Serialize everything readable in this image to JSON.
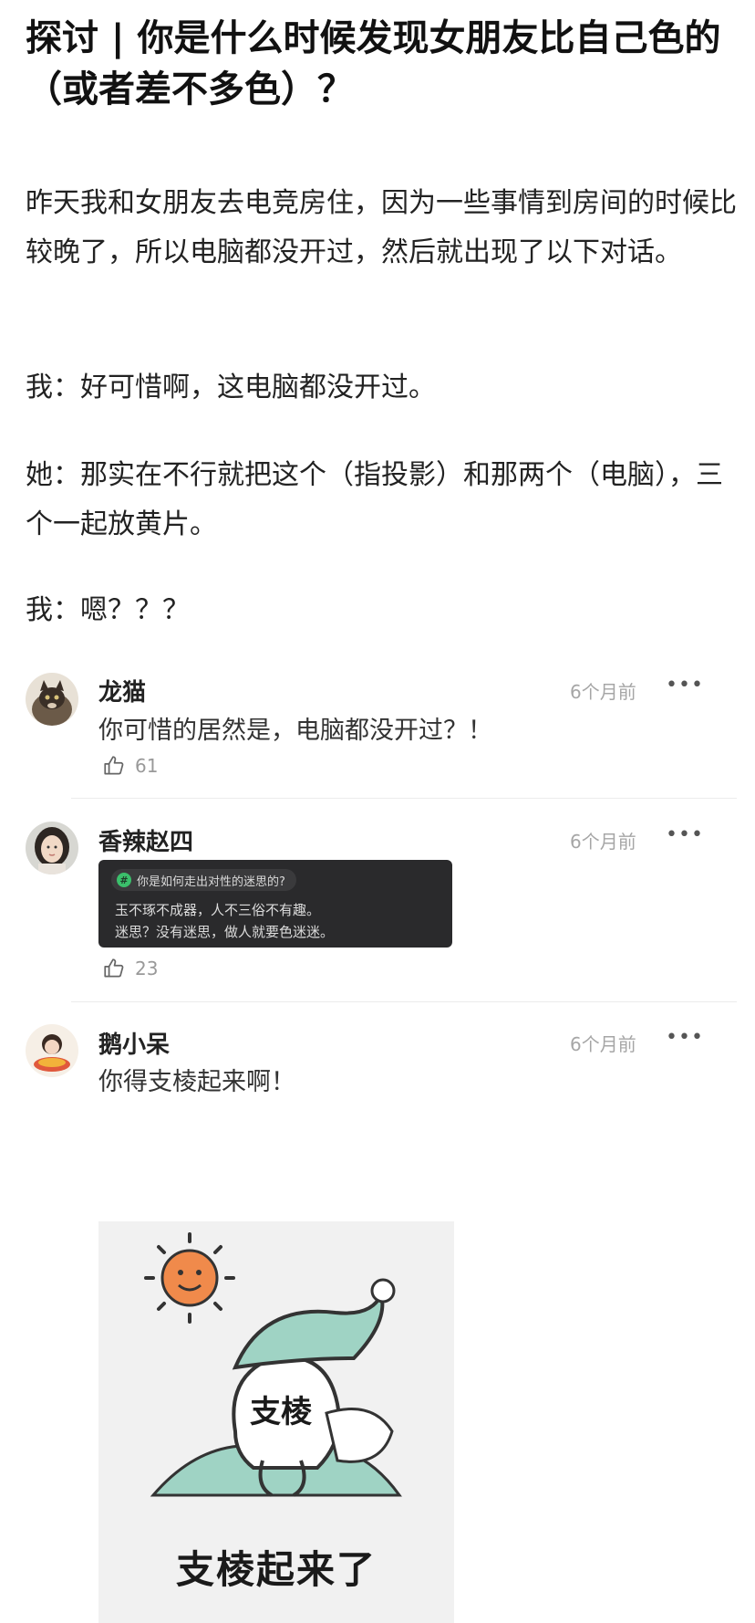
{
  "post": {
    "title": "探讨 | 你是什么时候发现女朋友比自己色的（或者差不多色）？",
    "paragraphs": [
      "昨天我和女朋友去电竞房住，因为一些事情到房间的时候比较晚了，所以电脑都没开过，然后就出现了以下对话。",
      "我：好可惜啊，这电脑都没开过。",
      "她：那实在不行就把这个（指投影）和那两个（电脑），三个一起放黄片。",
      "我：嗯？？？"
    ]
  },
  "comments": [
    {
      "name": "龙猫",
      "time": "6个月前",
      "text": "你可惜的居然是，电脑都没开过？！",
      "likes": "61",
      "avatar_icon": "cat-avatar"
    },
    {
      "name": "香辣赵四",
      "time": "6个月前",
      "quote_topic": "你是如何走出对性的迷思的?",
      "quote_lines": [
        "玉不琢不成器，人不三俗不有趣。",
        "迷思？没有迷思，做人就要色迷迷。"
      ],
      "likes": "23",
      "avatar_icon": "woman-avatar"
    },
    {
      "name": "鹅小呆",
      "time": "6个月前",
      "text": "你得支棱起来啊！",
      "avatar_icon": "girl-avatar",
      "meme_label": "支棱",
      "meme_caption": "支棱起来了"
    }
  ],
  "more_label": "•••",
  "colors": {
    "quote_bg": "#2a2a2c",
    "topic_green": "#3bbf6b",
    "meta_gray": "#a6a6a6"
  }
}
